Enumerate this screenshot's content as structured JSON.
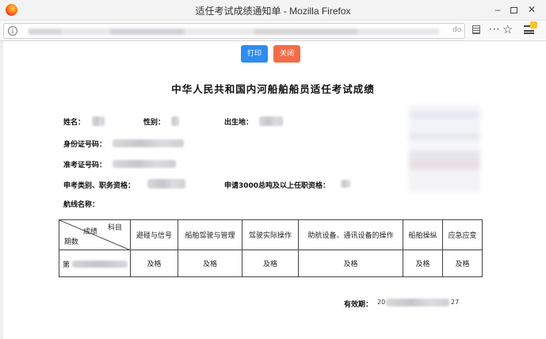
{
  "window": {
    "title": "适任考试成绩通知单 - Mozilla Firefox",
    "minimize": "–",
    "close": "✕"
  },
  "urlbar": {
    "info_symbol": "i",
    "url_suffix": "do"
  },
  "toolbar": {
    "more_symbol": "···",
    "star_symbol": "☆"
  },
  "buttons": {
    "print": "打印",
    "close": "关闭"
  },
  "document": {
    "title": "中华人民共和国内河船舶船员适任考试成绩",
    "fields": {
      "name_label": "姓名：",
      "gender_label": "性别：",
      "birthplace_label": "出生地：",
      "id_label": "身份证号码：",
      "admission_label": "准考证号码：",
      "category_label": "申考类别、职务资格：",
      "apply_label": "申请3000总吨及以上任职资格：",
      "route_label": "航线名称："
    },
    "table": {
      "corner_subject": "科目",
      "corner_score": "成绩",
      "corner_period": "期数",
      "headers": [
        "避碰与信号",
        "船舶驾驶与管理",
        "驾驶实际操作",
        "助航设备、通讯设备的操作",
        "船舶操纵",
        "应急应变"
      ],
      "period_prefix": "第",
      "results": [
        "及格",
        "及格",
        "及格",
        "及格",
        "及格",
        "及格"
      ]
    },
    "validity": {
      "label": "有效期：",
      "start": "20",
      "end": "27"
    }
  },
  "colors": {
    "print_button": "#2d8cf0",
    "close_button": "#f26c47"
  }
}
